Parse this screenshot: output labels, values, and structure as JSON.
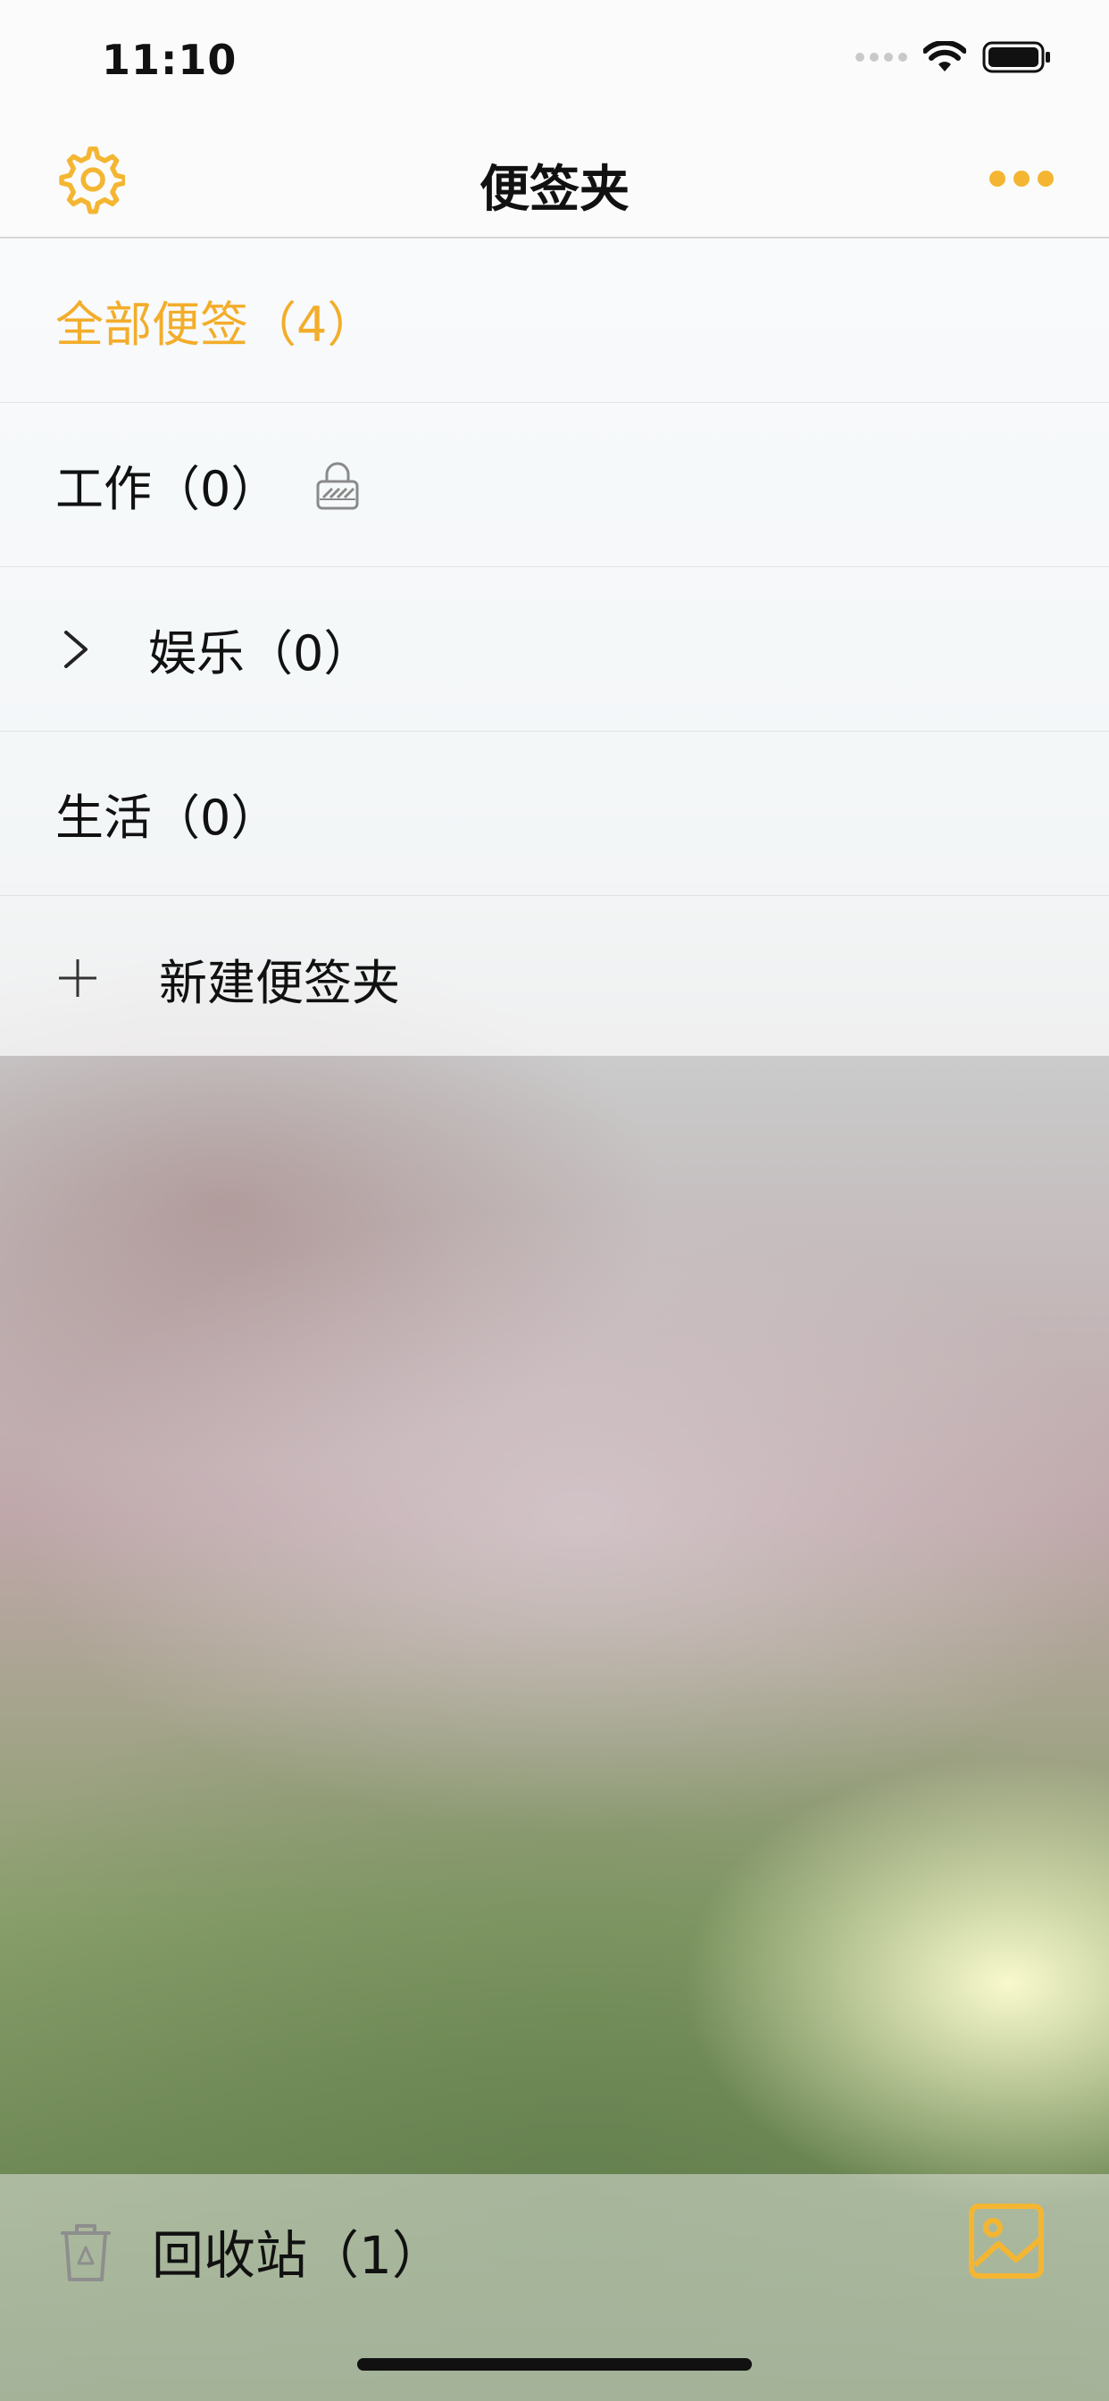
{
  "status_bar": {
    "time": "11:10"
  },
  "nav": {
    "title": "便签夹",
    "settings_icon": "gear-icon",
    "more_icon": "more-dots-icon"
  },
  "folders": [
    {
      "label": "全部便签（4）",
      "active": true
    },
    {
      "label": "工作（0）",
      "locked": true
    },
    {
      "label": "娱乐（0）",
      "expandable": true
    },
    {
      "label": "生活（0）"
    },
    {
      "label": "新建便签夹",
      "action": "add-folder"
    }
  ],
  "bottom": {
    "trash_label": "回收站（1）",
    "trash_icon": "trash-icon",
    "image_icon": "image-icon"
  },
  "colors": {
    "accent": "#F4B632",
    "active_text": "#F3AD2A"
  }
}
